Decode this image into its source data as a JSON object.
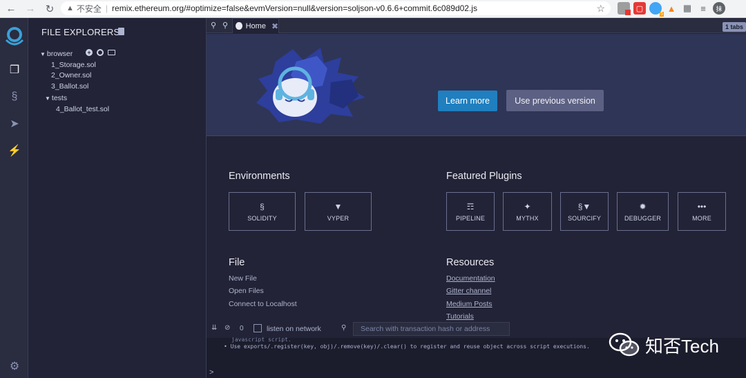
{
  "browser": {
    "warning_label": "不安全",
    "url": "remix.ethereum.org/#optimize=false&evmVersion=null&version=soljson-v0.6.6+commit.6c089d02.js",
    "avatar_initial": "抹"
  },
  "side_panel": {
    "title": "FILE EXPLORERS",
    "tree": {
      "root": "browser",
      "files": [
        "1_Storage.sol",
        "2_Owner.sol",
        "3_Ballot.sol"
      ],
      "folder": "tests",
      "folder_files": [
        "4_Ballot_test.sol"
      ]
    }
  },
  "tabs": {
    "home_label": "Home",
    "count_label": "1 tabs"
  },
  "hero": {
    "learn_more": "Learn more",
    "use_previous": "Use previous version"
  },
  "environments": {
    "title": "Environments",
    "items": [
      {
        "label": "SOLIDITY",
        "icon": "solidity-icon"
      },
      {
        "label": "VYPER",
        "icon": "vyper-icon"
      }
    ]
  },
  "featured_plugins": {
    "title": "Featured Plugins",
    "items": [
      {
        "label": "PIPELINE",
        "icon": "pipeline-icon"
      },
      {
        "label": "MYTHX",
        "icon": "mythx-icon"
      },
      {
        "label": "SOURCIFY",
        "icon": "sourcify-icon"
      },
      {
        "label": "DEBUGGER",
        "icon": "bug-icon"
      },
      {
        "label": "MORE",
        "icon": "more-icon"
      }
    ]
  },
  "file_section": {
    "title": "File",
    "links": [
      "New File",
      "Open Files",
      "Connect to Localhost"
    ]
  },
  "resources": {
    "title": "Resources",
    "links": [
      "Documentation",
      "Gitter channel",
      "Medium Posts",
      "Tutorials"
    ]
  },
  "terminal": {
    "count": "0",
    "listen_label": "listen on network",
    "search_placeholder": "Search with transaction hash or address",
    "line1": "javascript script.",
    "line2": "• Use exports/.register(key, obj)/.remove(key)/.clear() to register and reuse object across script executions.",
    "prompt": ">"
  },
  "watermark": {
    "text": "知否Tech"
  },
  "colors": {
    "accent_blue": "#1f7fbf",
    "panel_bg": "#222336",
    "hero_bg": "#2f3556"
  }
}
